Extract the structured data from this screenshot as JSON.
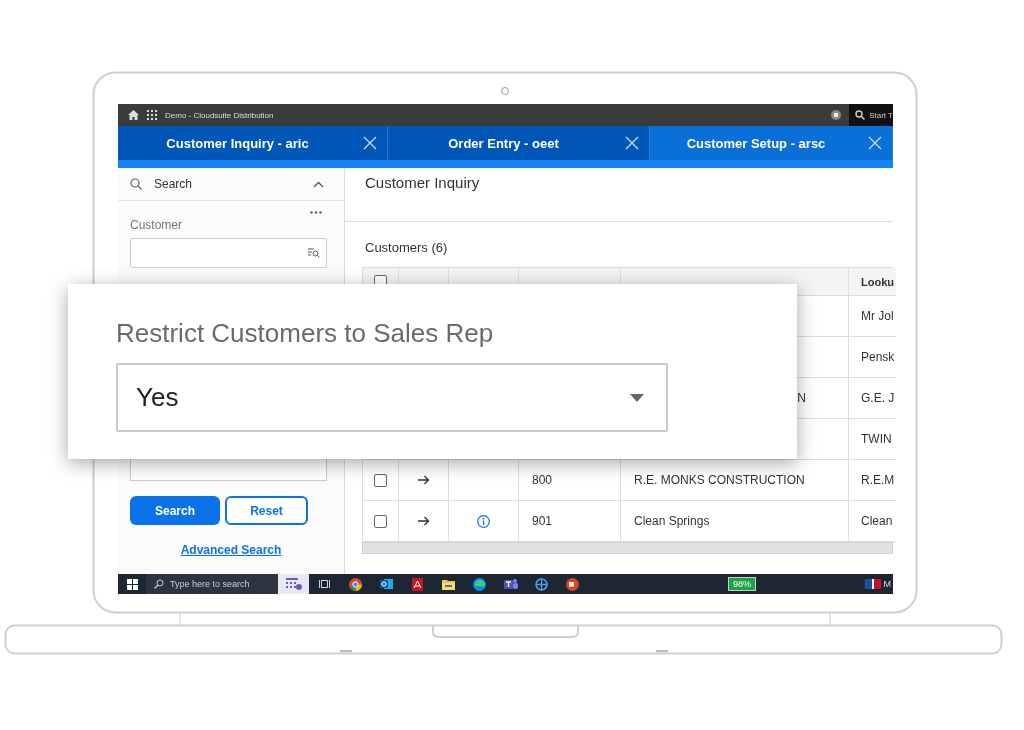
{
  "top_bar": {
    "title": "Demo - Cloudsuite Distribution",
    "search_text": "Start T"
  },
  "tabs": [
    {
      "label": "Customer Inquiry - aric",
      "selected": false
    },
    {
      "label": "Order Entry - oeet",
      "selected": false
    },
    {
      "label": "Customer Setup - arsc",
      "selected": true
    }
  ],
  "search_panel": {
    "title": "Search",
    "expanded": true,
    "field_label": "Customer",
    "buttons": [
      {
        "label": "Search",
        "kind": "primary"
      },
      {
        "label": "Reset",
        "kind": "secondary"
      }
    ],
    "link": "Advanced Search"
  },
  "main": {
    "title": "Customer Inquiry",
    "table": {
      "title": "Customers (6)",
      "header_checked": false,
      "columns": [
        "Looku"
      ],
      "rows": [
        {
          "kind": "covered",
          "name": "",
          "lookup": "Mr Jol"
        },
        {
          "kind": "covered",
          "name": "",
          "lookup": "Pensk"
        },
        {
          "kind": "covered",
          "name": "N",
          "lookup": "G.E. J"
        },
        {
          "kind": "covered",
          "name": "",
          "lookup": "TWIN"
        },
        {
          "kind": "visible",
          "checked": false,
          "note": false,
          "customer": "800",
          "name": "R.E. MONKS CONSTRUCTION",
          "lookup": "R.E.M"
        },
        {
          "kind": "visible",
          "checked": false,
          "note": true,
          "customer": "901",
          "name": "Clean Springs",
          "lookup": "Clean"
        }
      ]
    }
  },
  "popup": {
    "label": "Restrict Customers to Sales Rep",
    "value": "Yes"
  },
  "taskbar": {
    "search_placeholder": "Type here to search",
    "battery": "98%",
    "tray_text": "M"
  }
}
